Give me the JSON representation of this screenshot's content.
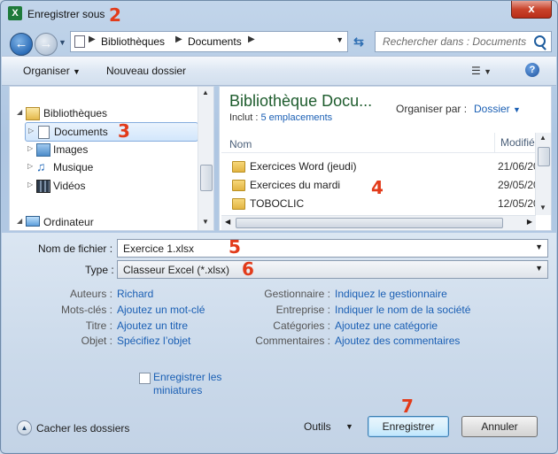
{
  "window": {
    "title": "Enregistrer sous",
    "close_glyph": "x"
  },
  "markers": [
    "2",
    "3",
    "4",
    "5",
    "6",
    "7"
  ],
  "nav": {
    "breadcrumb": [
      "Bibliothèques",
      "Documents"
    ],
    "search_placeholder": "Rechercher dans : Documents"
  },
  "toolbar": {
    "organise": "Organiser",
    "new_folder": "Nouveau dossier",
    "help": "?"
  },
  "tree": {
    "items": [
      {
        "label": "Bibliothèques",
        "icon": "library-icon"
      },
      {
        "label": "Documents",
        "icon": "documents-icon",
        "selected": true
      },
      {
        "label": "Images",
        "icon": "images-icon"
      },
      {
        "label": "Musique",
        "icon": "music-icon"
      },
      {
        "label": "Vidéos",
        "icon": "videos-icon"
      },
      {
        "label": "Ordinateur",
        "icon": "computer-icon"
      }
    ]
  },
  "library": {
    "title": "Bibliothèque Docu...",
    "includes_label": "Inclut :",
    "includes_link": "5 emplacements",
    "arrange_label": "Organiser par :",
    "arrange_value": "Dossier"
  },
  "files": {
    "columns": [
      "Nom",
      "Modifié"
    ],
    "rows": [
      {
        "name": "Exercices Word (jeudi)",
        "date": "21/06/20"
      },
      {
        "name": "Exercices du mardi",
        "date": "29/05/20"
      },
      {
        "name": "TOBOCLIC",
        "date": "12/05/20"
      }
    ]
  },
  "form": {
    "filename_label": "Nom de fichier :",
    "filename_value": "Exercice 1.xlsx",
    "type_label": "Type :",
    "type_value": "Classeur Excel (*.xlsx)"
  },
  "meta": {
    "left": [
      {
        "label": "Auteurs :",
        "value": "Richard"
      },
      {
        "label": "Mots-clés :",
        "value": "Ajoutez un mot-clé"
      },
      {
        "label": "Titre :",
        "value": "Ajoutez un titre"
      },
      {
        "label": "Objet :",
        "value": "Spécifiez l’objet"
      }
    ],
    "right": [
      {
        "label": "Gestionnaire :",
        "value": "Indiquez le gestionnaire"
      },
      {
        "label": "Entreprise :",
        "value": "Indiquer le nom de la société"
      },
      {
        "label": "Catégories :",
        "value": "Ajoutez une catégorie"
      },
      {
        "label": "Commentaires :",
        "value": "Ajoutez des commentaires"
      }
    ]
  },
  "thumbnails": {
    "label": "Enregistrer les miniatures",
    "checked": false
  },
  "footer": {
    "hide_folders": "Cacher les dossiers",
    "tools": "Outils",
    "save": "Enregistrer",
    "cancel": "Annuler"
  },
  "colors": {
    "marker": "#e23b1a",
    "link": "#1a5fb4",
    "library_title": "#1e5c2d"
  }
}
